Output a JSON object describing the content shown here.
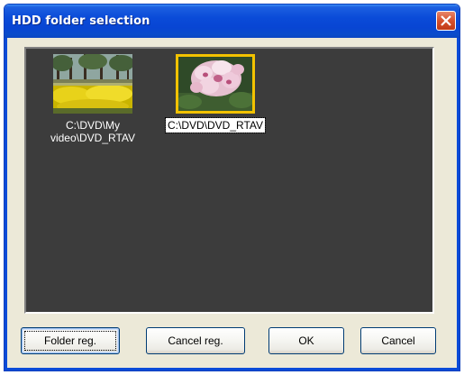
{
  "window": {
    "title": "HDD folder selection"
  },
  "folders": [
    {
      "path_line1": "C:\\DVD\\My",
      "path_line2": "video\\DVD_RTAV",
      "selected": false,
      "thumbnail": "tulip-park-photo"
    },
    {
      "path_line1": "C:\\DVD\\DVD_RTAV",
      "path_line2": "",
      "selected": true,
      "thumbnail": "pink-flower-photo"
    }
  ],
  "buttons": {
    "folder_reg": "Folder reg.",
    "cancel_reg": "Cancel reg.",
    "ok": "OK",
    "cancel": "Cancel"
  },
  "colors": {
    "titlebar": "#0a4bd8",
    "panel_background": "#3c3c3c",
    "selection_border": "#f2c200",
    "close_button": "#d5512d"
  },
  "icons": {
    "close": "close-icon"
  }
}
